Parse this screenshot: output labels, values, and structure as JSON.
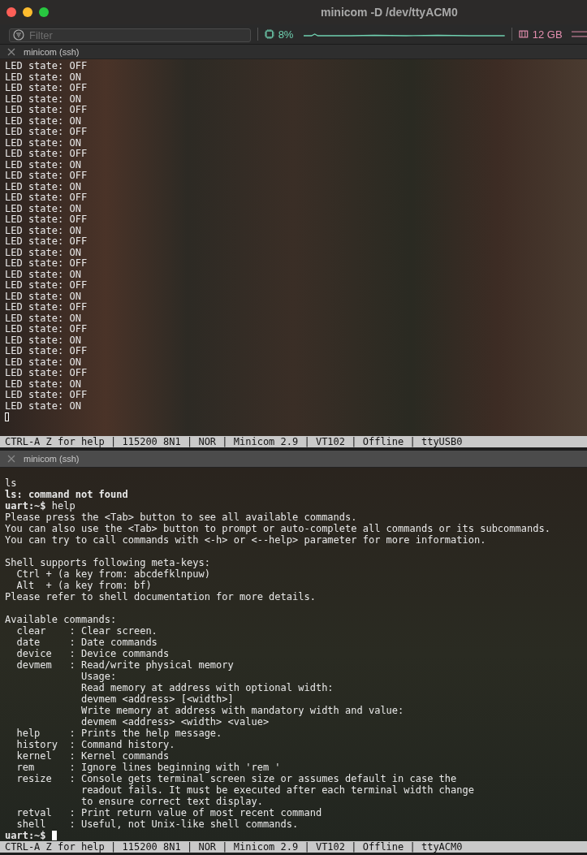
{
  "window": {
    "title": "minicom -D /dev/ttyACM0"
  },
  "toolbar": {
    "filter": {
      "placeholder": "Filter"
    },
    "cpu": {
      "reading": "8%"
    },
    "memory": {
      "reading": "12 GB"
    }
  },
  "panes": [
    {
      "tab": {
        "title": "minicom (ssh)",
        "active": false
      },
      "blocks": [
        {
          "lines": [
            {
              "text": "LED state: OFF"
            },
            {
              "text": "LED state: ON"
            },
            {
              "text": "LED state: OFF"
            },
            {
              "text": "LED state: ON"
            },
            {
              "text": "LED state: OFF"
            },
            {
              "text": "LED state: ON"
            },
            {
              "text": "LED state: OFF"
            },
            {
              "text": "LED state: ON"
            },
            {
              "text": "LED state: OFF"
            },
            {
              "text": "LED state: ON"
            },
            {
              "text": "LED state: OFF"
            },
            {
              "text": "LED state: ON"
            },
            {
              "text": "LED state: OFF"
            },
            {
              "text": "LED state: ON"
            },
            {
              "text": "LED state: OFF"
            },
            {
              "text": "LED state: ON"
            },
            {
              "text": "LED state: OFF"
            },
            {
              "text": "LED state: ON"
            },
            {
              "text": "LED state: OFF"
            },
            {
              "text": "LED state: ON"
            },
            {
              "text": "LED state: OFF"
            },
            {
              "text": "LED state: ON"
            },
            {
              "text": "LED state: OFF"
            },
            {
              "text": "LED state: ON"
            },
            {
              "text": "LED state: OFF"
            },
            {
              "text": "LED state: ON"
            },
            {
              "text": "LED state: OFF"
            },
            {
              "text": "LED state: ON"
            },
            {
              "text": "LED state: OFF"
            },
            {
              "text": "LED state: ON"
            },
            {
              "text": "LED state: OFF"
            },
            {
              "text": "LED state: ON"
            },
            {
              "cursor": true
            }
          ]
        }
      ],
      "status_bar": "CTRL-A Z for help | 115200 8N1 | NOR | Minicom 2.9 | VT102 | Offline | ttyUSB0"
    },
    {
      "tab": {
        "title": "minicom (ssh)",
        "active": true
      },
      "blocks": [
        {
          "lines": [
            {
              "text": "ls"
            },
            {
              "text": "ls: command not found",
              "bold": true
            },
            {
              "text": "**uart:~$** help"
            },
            {
              "text": "Please press the <Tab> button to see all available commands."
            },
            {
              "text": "You can also use the <Tab> button to prompt or auto-complete all commands or its subcommands."
            },
            {
              "text": "You can try to call commands with <-h> or <--help> parameter for more information."
            }
          ]
        },
        {
          "lines": [
            {
              "text": "Shell supports following meta-keys:"
            },
            {
              "text": "  Ctrl + (a key from: abcdefklnpuw)"
            },
            {
              "text": "  Alt  + (a key from: bf)"
            },
            {
              "text": "Please refer to shell documentation for more details."
            }
          ]
        },
        {
          "lines": [
            {
              "text": "Available commands:"
            },
            {
              "text": "  clear    : Clear screen."
            },
            {
              "text": "  date     : Date commands"
            },
            {
              "text": "  device   : Device commands"
            },
            {
              "text": "  devmem   : Read/write physical memory"
            },
            {
              "text": "             Usage:"
            },
            {
              "text": "             Read memory at address with optional width:"
            },
            {
              "text": "             devmem <address> [<width>]"
            },
            {
              "text": "             Write memory at address with mandatory width and value:"
            },
            {
              "text": "             devmem <address> <width> <value>"
            },
            {
              "text": "  help     : Prints the help message."
            },
            {
              "text": "  history  : Command history."
            },
            {
              "text": "  kernel   : Kernel commands"
            },
            {
              "text": "  rem      : Ignore lines beginning with 'rem '"
            },
            {
              "text": "  resize   : Console gets terminal screen size or assumes default in case the"
            },
            {
              "text": "             readout fails. It must be executed after each terminal width change"
            },
            {
              "text": "             to ensure correct text display."
            },
            {
              "text": "  retval   : Print return value of most recent command"
            },
            {
              "text": "  shell    : Useful, not Unix-like shell commands."
            },
            {
              "text": "**uart:~$** ",
              "cursor": true
            }
          ]
        }
      ],
      "status_bar": "CTRL-A Z for help | 115200 8N1 | NOR | Minicom 2.9 | VT102 | Offline | ttyACM0"
    }
  ]
}
